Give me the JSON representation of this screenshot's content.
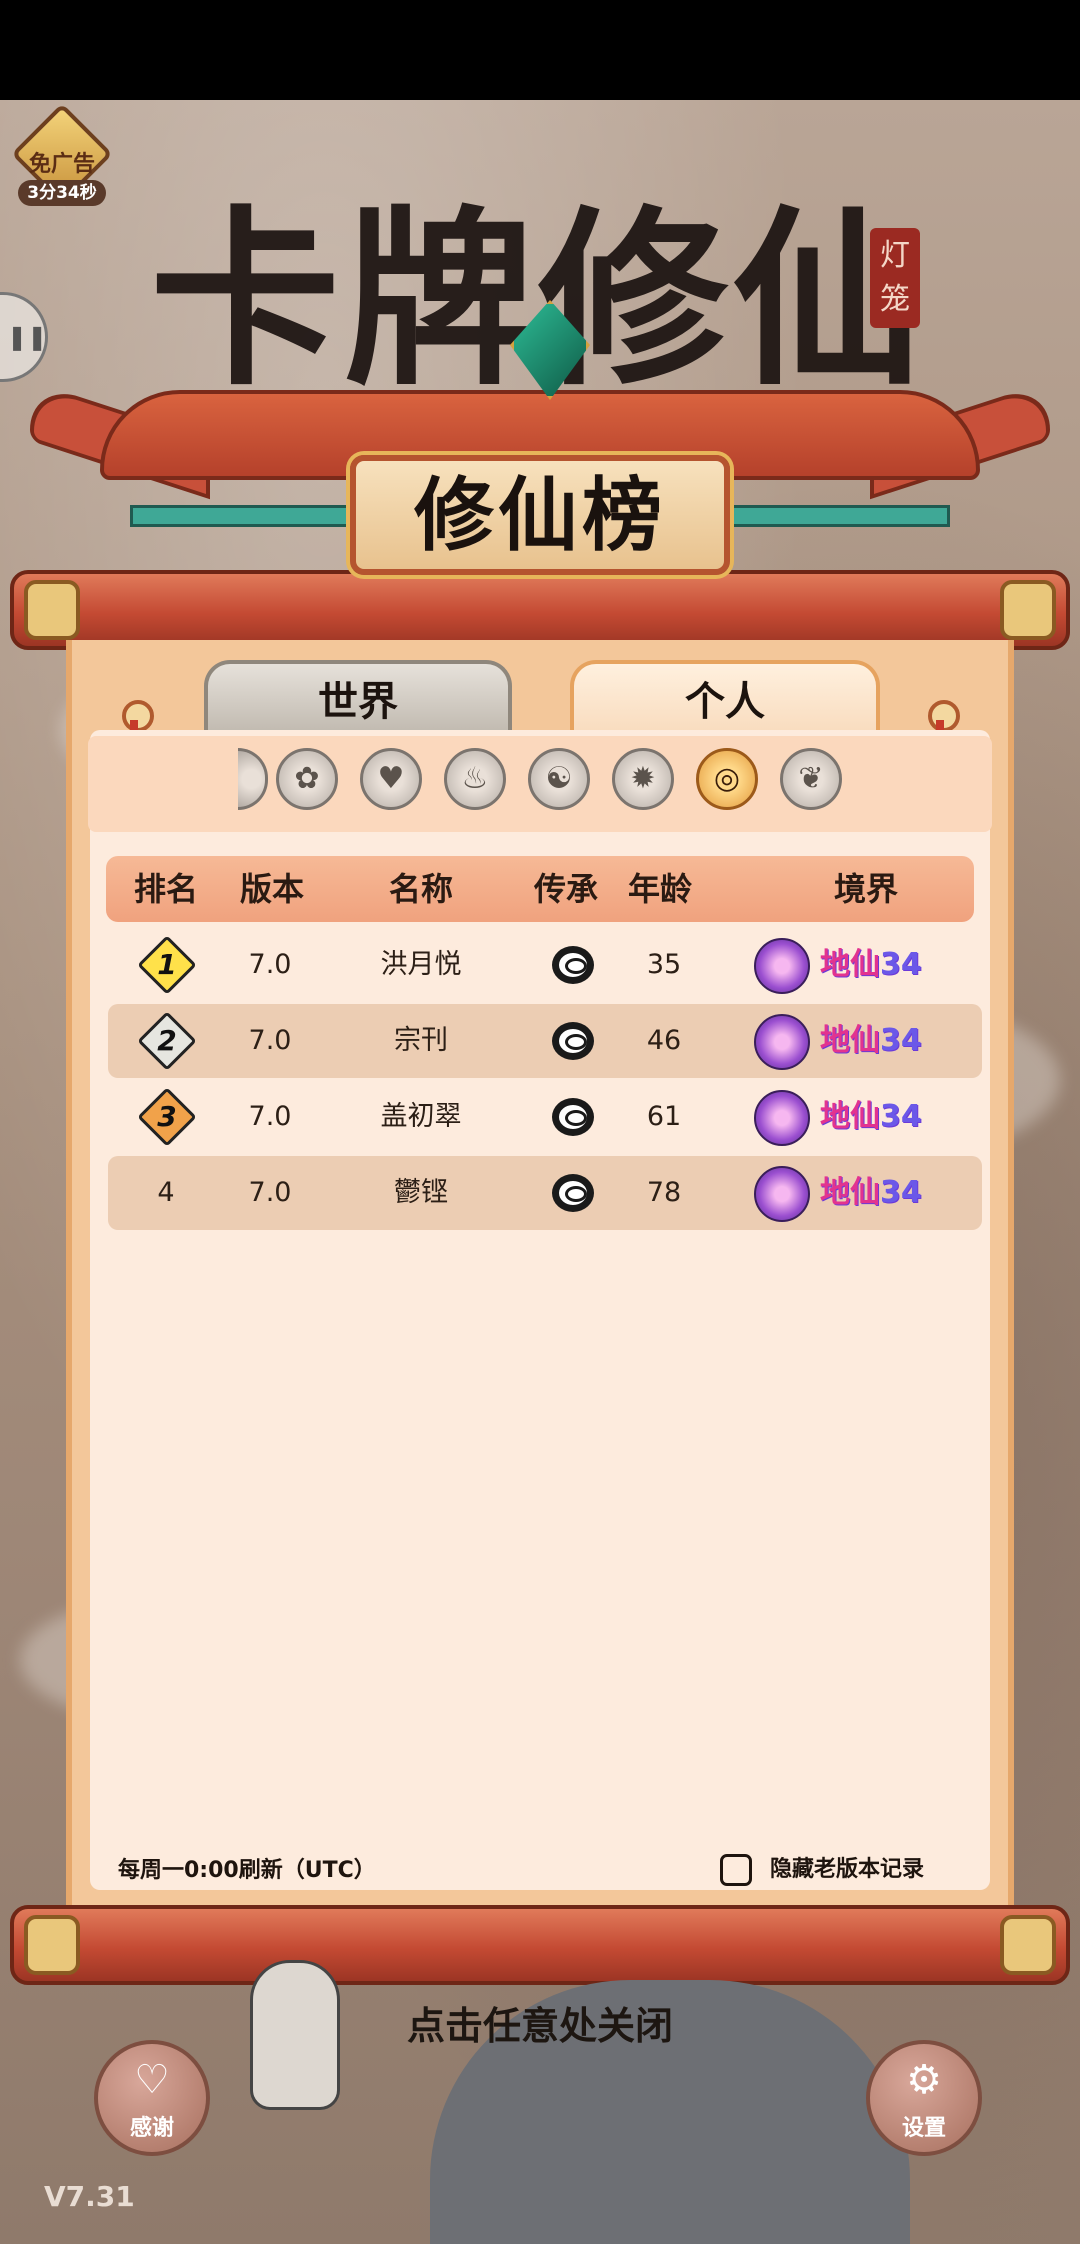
{
  "ad": {
    "label": "免广告",
    "timer": "3分34秒"
  },
  "logo": {
    "title": "卡牌修仙",
    "seal": "灯笼"
  },
  "plaque_title": "修仙榜",
  "tabs": [
    {
      "label": "世界",
      "active": false
    },
    {
      "label": "个人",
      "active": true
    }
  ],
  "categories": [
    {
      "icon": "partial-category-icon",
      "glyph": ""
    },
    {
      "icon": "book-icon",
      "glyph": "✿"
    },
    {
      "icon": "heart-icon",
      "glyph": "♥"
    },
    {
      "icon": "fire-icon",
      "glyph": "♨"
    },
    {
      "icon": "yin-yang-icon",
      "glyph": "☯"
    },
    {
      "icon": "flame-icon",
      "glyph": "✹"
    },
    {
      "icon": "ring-icon",
      "glyph": "◎",
      "active": true
    },
    {
      "icon": "spirit-icon",
      "glyph": "❦"
    }
  ],
  "table": {
    "headers": [
      "排名",
      "版本",
      "名称",
      "传承",
      "年龄",
      "境界"
    ],
    "rows": [
      {
        "rank": "1",
        "version": "7.0",
        "name": "洪月悦",
        "inheritance": "ring-icon",
        "age": "35",
        "realm": "地仙",
        "realm_level": "34"
      },
      {
        "rank": "2",
        "version": "7.0",
        "name": "宗刊",
        "inheritance": "ring-icon",
        "age": "46",
        "realm": "地仙",
        "realm_level": "34"
      },
      {
        "rank": "3",
        "version": "7.0",
        "name": "盖初翠",
        "inheritance": "ring-icon",
        "age": "61",
        "realm": "地仙",
        "realm_level": "34"
      },
      {
        "rank": "4",
        "version": "7.0",
        "name": "鬱铿",
        "inheritance": "ring-icon",
        "age": "78",
        "realm": "地仙",
        "realm_level": "34"
      }
    ]
  },
  "footer": {
    "refresh_note": "每周一0:00刷新（UTC）",
    "hide_old_label": "隐藏老版本记录",
    "hide_old_checked": false
  },
  "close_hint": "点击任意处关闭",
  "buttons": {
    "thanks": "感谢",
    "settings": "设置"
  },
  "version": "V7.31",
  "colors": {
    "realm_text": "#e2338f",
    "realm_level": "#6b58e8",
    "panel": "#fdebdd",
    "header": "#f0a27e"
  }
}
